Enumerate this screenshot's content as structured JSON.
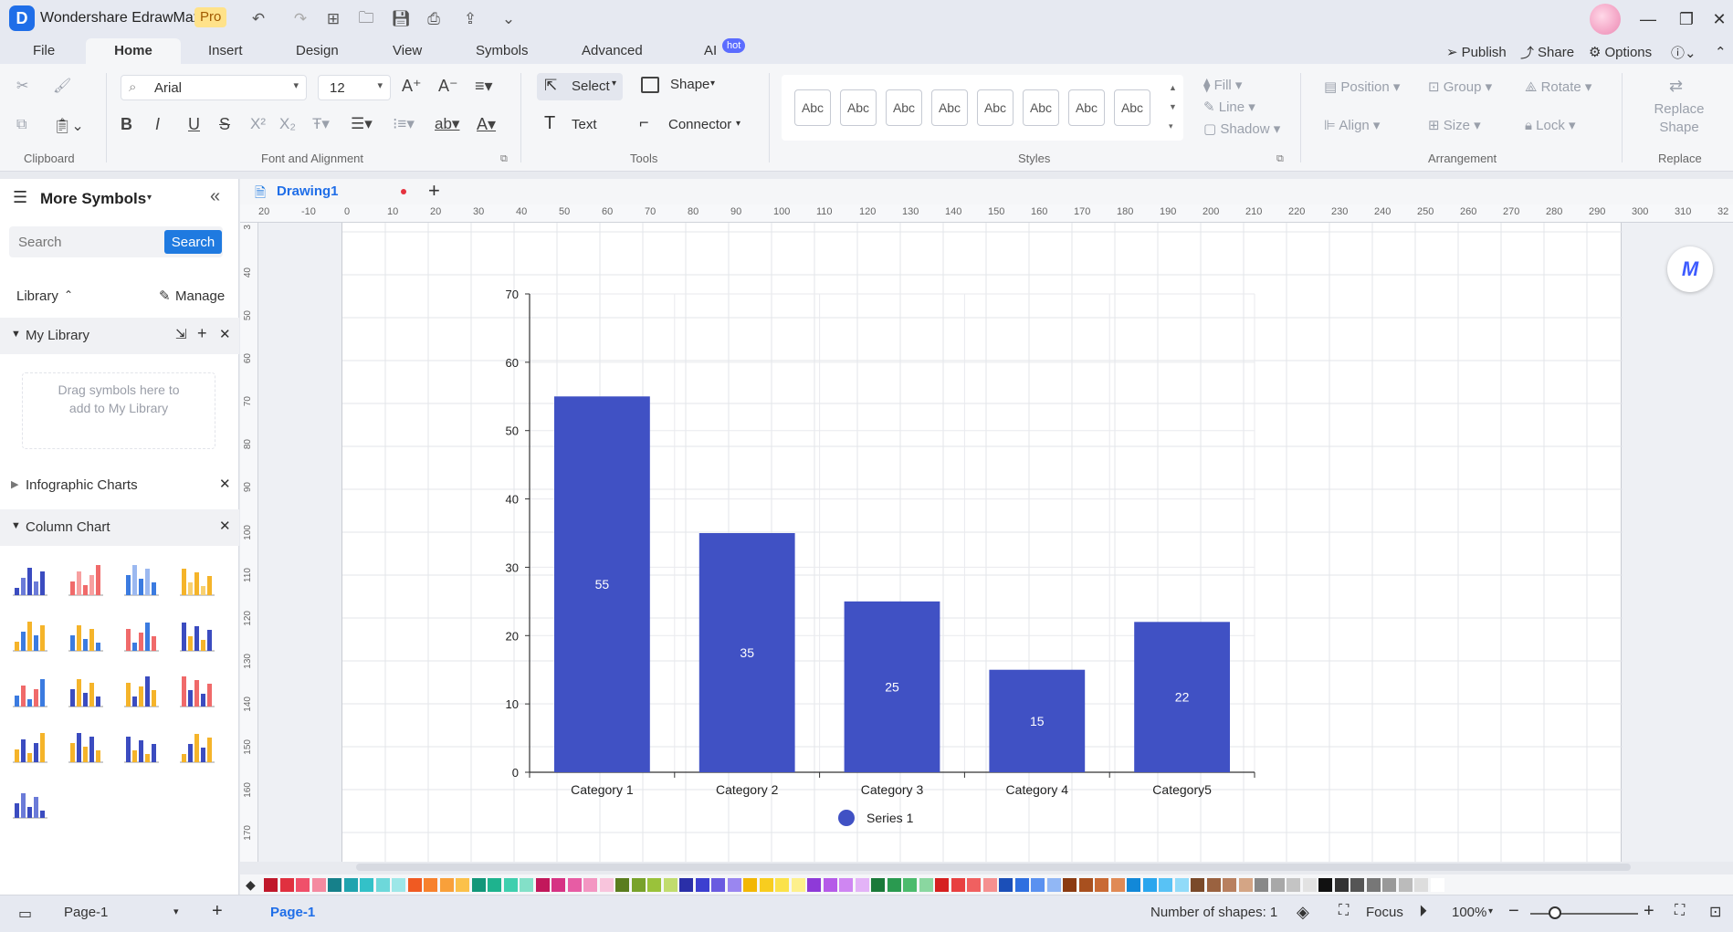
{
  "app": {
    "title": "Wondershare EdrawMax",
    "badge": "Pro",
    "logo_letter": "D"
  },
  "menu": {
    "tabs": [
      "File",
      "Home",
      "Insert",
      "Design",
      "View",
      "Symbols",
      "Advanced",
      "AI"
    ],
    "hot_badge": "hot",
    "publish": "Publish",
    "share": "Share",
    "options": "Options"
  },
  "ribbon": {
    "font_name": "Arial",
    "font_size": "12",
    "select": "Select",
    "shape": "Shape",
    "text": "Text",
    "connector": "Connector",
    "style_samples": [
      "Abc",
      "Abc",
      "Abc",
      "Abc",
      "Abc",
      "Abc",
      "Abc",
      "Abc"
    ],
    "fill": "Fill",
    "line": "Line",
    "shadow": "Shadow",
    "position": "Position",
    "group": "Group",
    "rotate": "Rotate",
    "align": "Align",
    "size": "Size",
    "lock": "Lock",
    "replace_shape": "Replace Shape",
    "groups": {
      "clipboard": "Clipboard",
      "font": "Font and Alignment",
      "tools": "Tools",
      "styles": "Styles",
      "arrangement": "Arrangement",
      "replace": "Replace"
    }
  },
  "left_panel": {
    "title": "More Symbols",
    "search_placeholder": "Search",
    "search_button": "Search",
    "library": "Library",
    "manage": "Manage",
    "my_library": "My Library",
    "drag_hint": "Drag symbols here to add to My Library",
    "infographic": "Infographic Charts",
    "column_chart": "Column Chart"
  },
  "document": {
    "tab_name": "Drawing1",
    "ruler_h": [
      "20",
      "-10",
      "0",
      "10",
      "20",
      "30",
      "40",
      "50",
      "60",
      "70",
      "80",
      "90",
      "100",
      "110",
      "120",
      "130",
      "140",
      "150",
      "160",
      "170",
      "180",
      "190",
      "200",
      "210",
      "220",
      "230",
      "240",
      "250",
      "260",
      "270",
      "280",
      "290",
      "300",
      "310",
      "32"
    ],
    "ruler_v": [
      "3",
      "40",
      "50",
      "60",
      "70",
      "80",
      "90",
      "100",
      "110",
      "120",
      "130",
      "140",
      "150",
      "160",
      "170"
    ]
  },
  "chart_data": {
    "type": "bar",
    "categories": [
      "Category 1",
      "Category 2",
      "Category 3",
      "Category 4",
      "Category5"
    ],
    "series": [
      {
        "name": "Series 1",
        "values": [
          55,
          35,
          25,
          15,
          22
        ]
      }
    ],
    "data_labels": [
      "55",
      "35",
      "25",
      "15",
      "22"
    ],
    "y_ticks": [
      "0",
      "10",
      "20",
      "30",
      "40",
      "50",
      "60",
      "70"
    ],
    "ylim": [
      0,
      70
    ],
    "title": "",
    "xlabel": "",
    "ylabel": "",
    "legend_position": "bottom",
    "bar_color": "#4051c4",
    "grid": true
  },
  "status": {
    "page_select": "Page-1",
    "page_tab": "Page-1",
    "shapes": "Number of shapes: 1",
    "focus": "Focus",
    "zoom": "100%"
  },
  "palette": [
    "#c0182b",
    "#e0303f",
    "#f0506a",
    "#f48aa0",
    "#16808a",
    "#20a3ae",
    "#33c1c8",
    "#6dd8da",
    "#9de7e8",
    "#f05a22",
    "#f7812d",
    "#f9a03a",
    "#fbc14a",
    "#12977a",
    "#1eb38e",
    "#3fcfae",
    "#83e0c8",
    "#c2185b",
    "#d63384",
    "#e75ca4",
    "#f396c2",
    "#f8c4dc",
    "#5a7d1e",
    "#78a22a",
    "#9ac23a",
    "#c1dc6e",
    "#2a2fa8",
    "#3c3fd0",
    "#6a5be0",
    "#9a86f0",
    "#f2b705",
    "#f8cd1f",
    "#fbe24b",
    "#fdf08c",
    "#8e3ad8",
    "#b55be8",
    "#cf86f2",
    "#e3b3f7",
    "#1b7a3a",
    "#2a9a50",
    "#4cbb6d",
    "#8ad7a0",
    "#d62020",
    "#e84040",
    "#f06060",
    "#f59090",
    "#1b4fb8",
    "#2f6fe0",
    "#5a91f0",
    "#91b7f5",
    "#8b3b12",
    "#a8501f",
    "#c96a34",
    "#e08a55",
    "#1288d8",
    "#2aa6ee",
    "#58c2f5",
    "#91dbf9",
    "#7a4a2a",
    "#9a6240",
    "#b88060",
    "#d4a585",
    "#888888",
    "#a8a8a8",
    "#c4c4c4",
    "#e2e2e2",
    "#111111",
    "#333333",
    "#555555",
    "#777777",
    "#999999",
    "#bbbbbb",
    "#dddddd",
    "#ffffff"
  ]
}
